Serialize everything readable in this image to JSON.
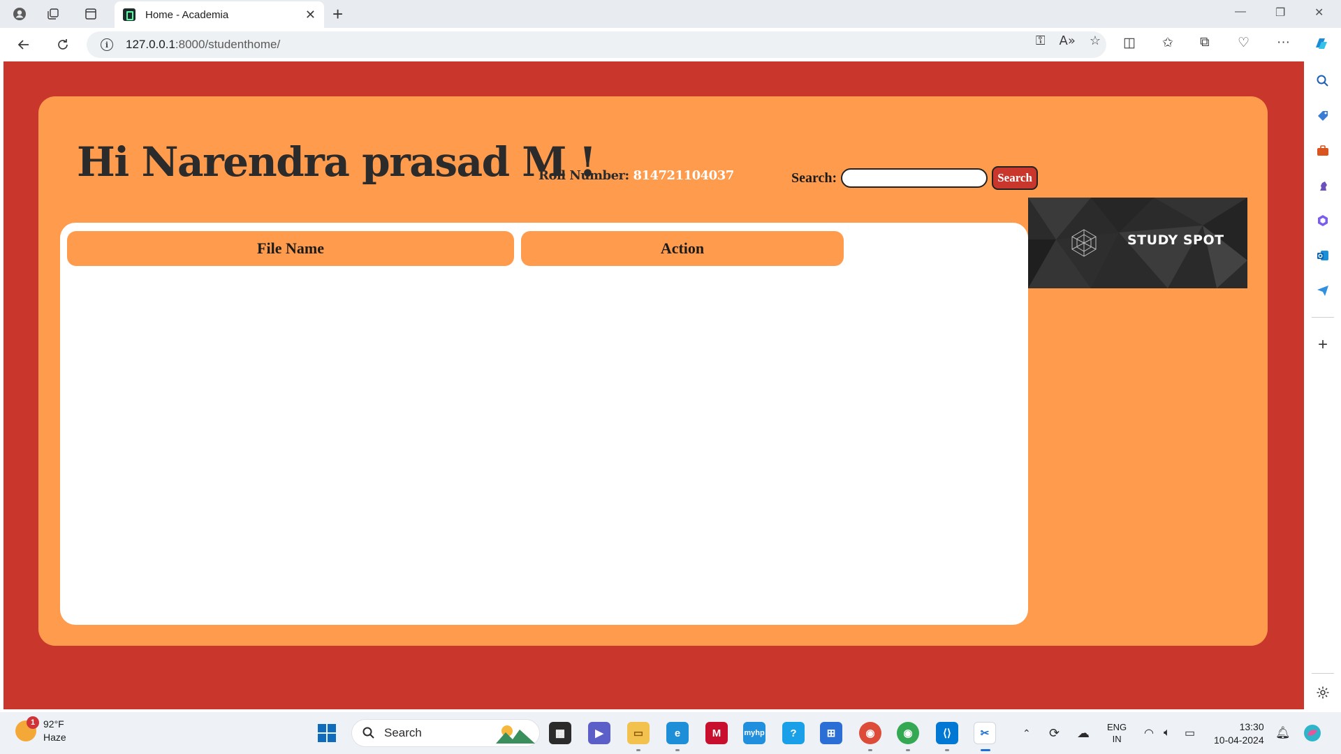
{
  "browser": {
    "tab_title": "Home - Academia",
    "url_host": "127.0.0.1",
    "url_path": ":8000/studenthome/"
  },
  "page": {
    "greeting": "Hi Narendra prasad M !",
    "roll_label": "Roll Number:",
    "roll_number": "814721104037",
    "search_label": "Search:",
    "search_value": "",
    "search_button": "Search",
    "table_headers": [
      "File Name",
      "Action"
    ],
    "table_rows": [],
    "logo_text": "STUDY SPOT"
  },
  "taskbar": {
    "temperature": "92°F",
    "condition": "Haze",
    "weather_badge": "1",
    "search_label": "Search",
    "lang_primary": "ENG",
    "lang_secondary": "IN",
    "time": "13:30",
    "date": "10-04-2024"
  },
  "colors": {
    "page_bg": "#c9372c",
    "card_bg": "#ff9b4d",
    "header_cell": "#ff9b4d",
    "search_button": "#c9372c"
  }
}
